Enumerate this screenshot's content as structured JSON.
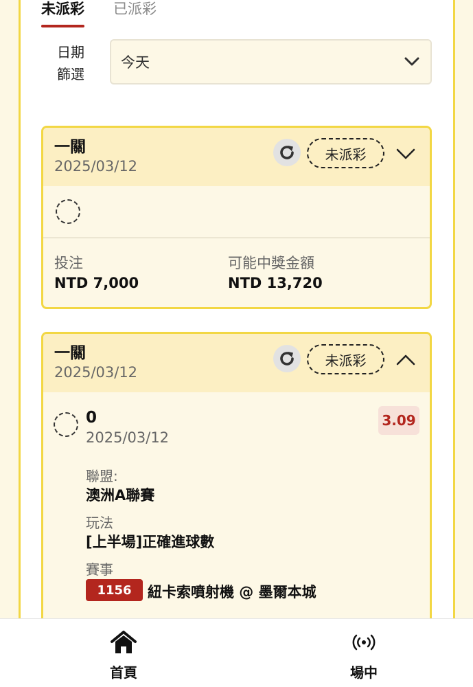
{
  "tabs": {
    "unsettled": "未派彩",
    "settled": "已派彩"
  },
  "filter": {
    "label": "日期篩選",
    "value": "今天"
  },
  "cards": [
    {
      "title": "一關",
      "date": "2025/03/12",
      "status": "未派彩",
      "expanded": false,
      "stake_label": "投注",
      "stake_value": "NTD 7,000",
      "payout_label": "可能中獎金額",
      "payout_value": "NTD 13,720"
    },
    {
      "title": "一關",
      "date": "2025/03/12",
      "status": "未派彩",
      "expanded": true,
      "selection": {
        "name": "0",
        "date": "2025/03/12",
        "odds": "3.09",
        "league_label": "聯盟:",
        "league_value": "澳洲A聯賽",
        "market_label": "玩法",
        "market_value": "[上半場]正確進球數",
        "event_label": "賽事",
        "event_id": "1156",
        "event_name": "紐卡索噴射機 @ 墨爾本城"
      }
    }
  ],
  "nav": {
    "home": "首頁",
    "live": "場中"
  },
  "colors": {
    "accent": "#b3261e",
    "border": "#f2d744",
    "header_bg": "#fcefc3"
  },
  "icons": [
    "chevron-down-icon",
    "refresh-icon",
    "chevron-up-icon",
    "loading-spinner-icon",
    "home-icon",
    "live-broadcast-icon"
  ]
}
